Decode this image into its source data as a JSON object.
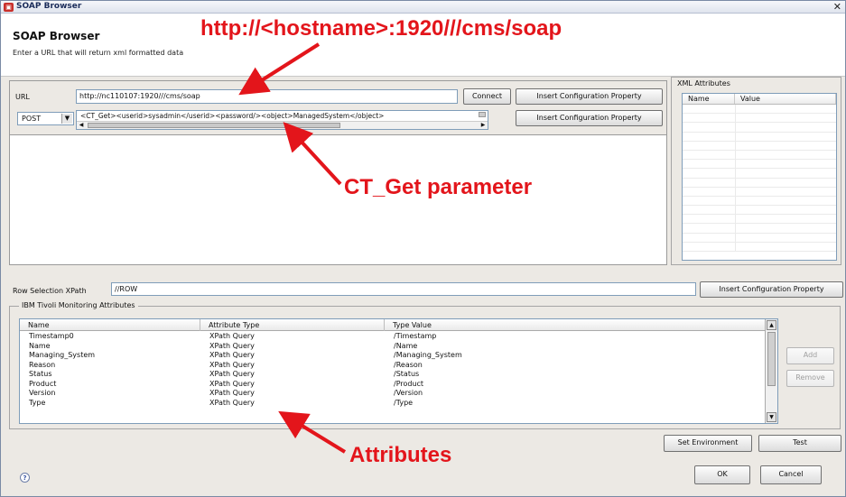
{
  "window": {
    "title": "SOAP Browser",
    "close_glyph": "✕"
  },
  "header": {
    "title": "SOAP Browser",
    "description": "Enter a URL that will return xml formatted data"
  },
  "annotations": {
    "url": "http://<hostname>:1920///cms/soap",
    "ct_get": "CT_Get parameter",
    "attributes": "Attributes",
    "color": "#e3151b"
  },
  "url_section": {
    "label": "URL",
    "value": "http://nc110107:1920///cms/soap",
    "connect": "Connect",
    "insert_config_1": "Insert Configuration Property",
    "insert_config_2": "Insert Configuration Property",
    "method": "POST",
    "body": "<CT_Get><userid>sysadmin</userid><password/><object>ManagedSystem</object>"
  },
  "xml_attributes": {
    "title": "XML Attributes",
    "columns": [
      "Name",
      "Value"
    ]
  },
  "xpath": {
    "label": "Row Selection XPath",
    "value": "//ROW",
    "insert_config": "Insert Configuration Property"
  },
  "ibm_group": {
    "title": "IBM Tivoli Monitoring Attributes",
    "columns": [
      "Name",
      "Attribute Type",
      "Type Value"
    ],
    "rows": [
      [
        "Timestamp0",
        "XPath Query",
        "/Timestamp"
      ],
      [
        "Name",
        "XPath Query",
        "/Name"
      ],
      [
        "Managing_System",
        "XPath Query",
        "/Managing_System"
      ],
      [
        "Reason",
        "XPath Query",
        "/Reason"
      ],
      [
        "Status",
        "XPath Query",
        "/Status"
      ],
      [
        "Product",
        "XPath Query",
        "/Product"
      ],
      [
        "Version",
        "XPath Query",
        "/Version"
      ],
      [
        "Type",
        "XPath Query",
        "/Type"
      ]
    ],
    "add": "Add",
    "remove": "Remove"
  },
  "footer": {
    "set_environment": "Set Environment",
    "test": "Test",
    "ok": "OK",
    "cancel": "Cancel",
    "help": "?"
  }
}
